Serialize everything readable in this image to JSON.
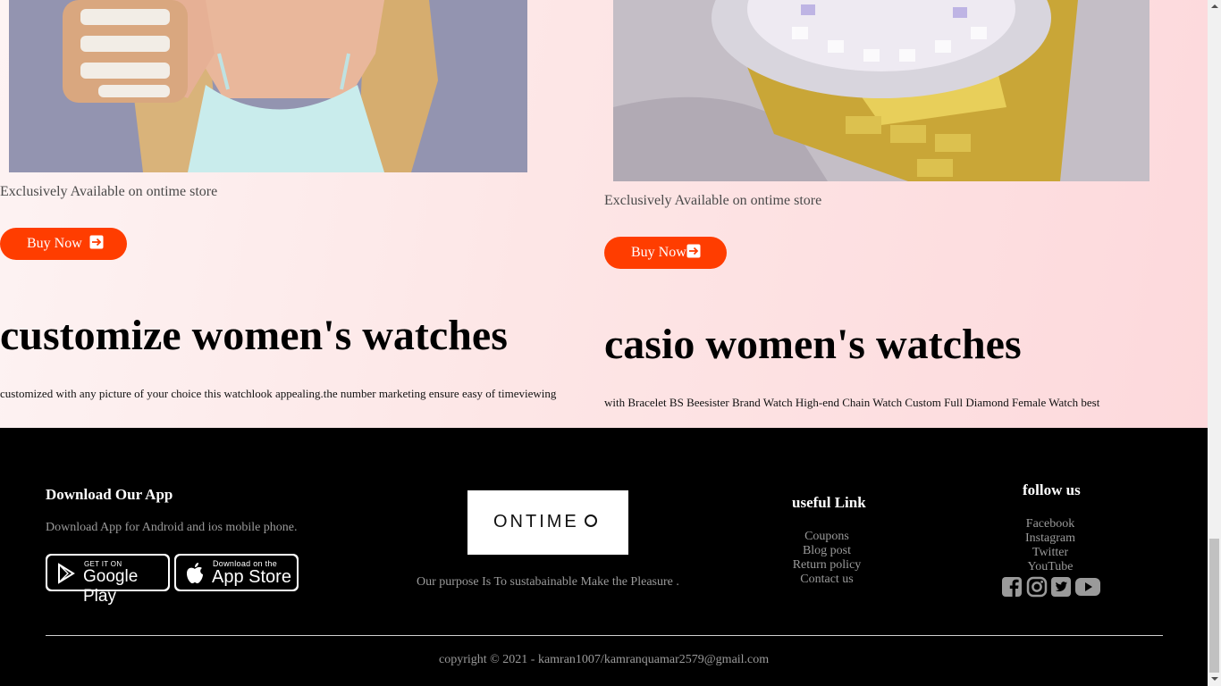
{
  "products": [
    {
      "tagline": "Exclusively Available on ontime store",
      "button_label": "Buy Now",
      "title": "customize women's watches",
      "description": "customized with any picture of your choice this watchlook appealing.the number marketing ensure easy of timeviewing"
    },
    {
      "tagline": "Exclusively Available on ontime store",
      "button_label": "Buy Now",
      "title": "casio women's watches",
      "description": "with Bracelet BS Beesister Brand Watch High-end Chain Watch Custom Full Diamond Female Watch best"
    }
  ],
  "footer": {
    "app": {
      "title": "Download Our App",
      "text": "Download App for Android and ios mobile phone.",
      "google_small": "GET IT ON",
      "google_big": "Google Play",
      "apple_small": "Download on the",
      "apple_big": "App Store"
    },
    "brand": {
      "logo_text": "ONTIME",
      "purpose": "Our purpose Is To sustabainable Make the Pleasure ."
    },
    "useful": {
      "title": "useful Link",
      "links": [
        "Coupons",
        "Blog post",
        "Return policy",
        "Contact us"
      ]
    },
    "follow": {
      "title": "follow us",
      "links": [
        "Facebook",
        "Instagram",
        "Twitter",
        "YouTube"
      ],
      "icons": [
        "facebook-icon",
        "instagram-icon",
        "twitter-icon",
        "youtube-icon"
      ]
    },
    "copyright": "copyright © 2021 - kamran1007/kamranquamar2579@gmail.com"
  },
  "colors": {
    "accent": "#ff3d00",
    "footer_bg": "#000000",
    "footer_text": "#9a9a9a"
  }
}
